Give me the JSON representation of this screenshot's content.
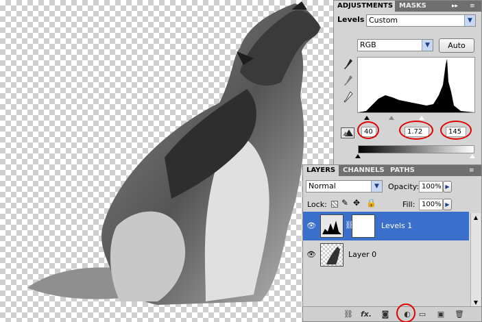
{
  "adjustments": {
    "tabs": [
      "ADJUSTMENTS",
      "MASKS"
    ],
    "tab_controls": "▸▸",
    "menu_icon": "panel-menu-icon",
    "title": "Levels",
    "preset": "Custom",
    "channel": "RGB",
    "auto_label": "Auto",
    "input_black": "40",
    "input_gamma": "1.72",
    "input_white": "145"
  },
  "layers": {
    "tabs": [
      "LAYERS",
      "CHANNELS",
      "PATHS"
    ],
    "blend_mode": "Normal",
    "opacity_label": "Opacity:",
    "opacity_value": "100%",
    "lock_label": "Lock:",
    "fill_label": "Fill:",
    "fill_value": "100%",
    "items": [
      {
        "name": "Levels 1",
        "selected": true
      },
      {
        "name": "Layer 0",
        "selected": false
      }
    ],
    "bottom_icons": [
      "link-layers-icon",
      "fx-icon",
      "add-mask-icon",
      "new-adjustment-layer-icon",
      "new-group-icon",
      "new-layer-icon",
      "delete-layer-icon"
    ],
    "fx_label": "fx."
  },
  "colors": {
    "annotation_red": "#e00000",
    "selection_blue": "#3a6fcc",
    "panel_gray": "#d4d4d4",
    "tab_dark": "#6f6f6f"
  }
}
